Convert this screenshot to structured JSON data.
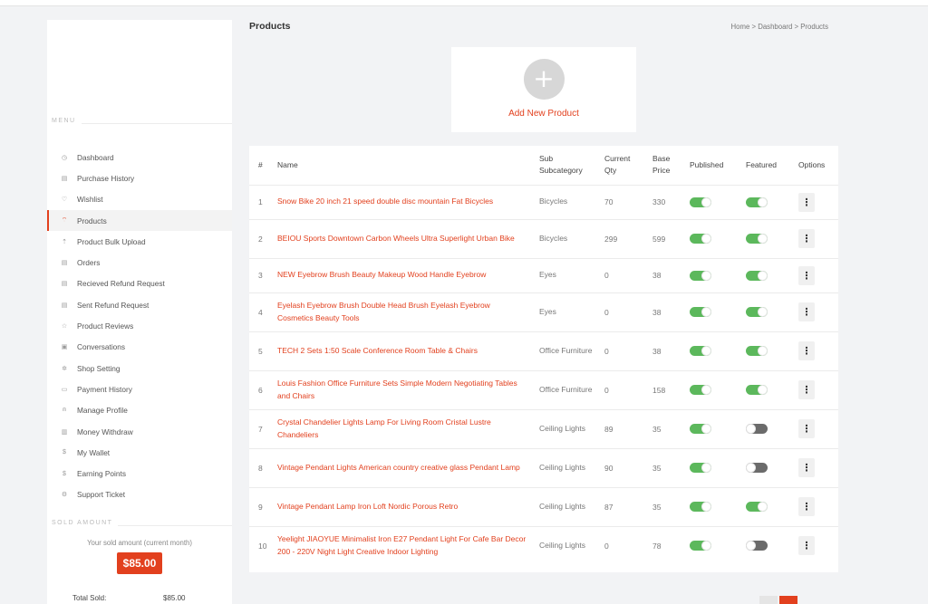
{
  "sidebar": {
    "menu_heading": "MENU",
    "items": [
      {
        "label": "Dashboard",
        "icon": "◷"
      },
      {
        "label": "Purchase History",
        "icon": "▤"
      },
      {
        "label": "Wishlist",
        "icon": "♡"
      },
      {
        "label": "Products",
        "icon": "⌔"
      },
      {
        "label": "Product Bulk Upload",
        "icon": "⇡"
      },
      {
        "label": "Orders",
        "icon": "▤"
      },
      {
        "label": "Recieved Refund Request",
        "icon": "▤"
      },
      {
        "label": "Sent Refund Request",
        "icon": "▤"
      },
      {
        "label": "Product Reviews",
        "icon": "☆"
      },
      {
        "label": "Conversations",
        "icon": "▣"
      },
      {
        "label": "Shop Setting",
        "icon": "✲"
      },
      {
        "label": "Payment History",
        "icon": "▭"
      },
      {
        "label": "Manage Profile",
        "icon": "⍝"
      },
      {
        "label": "Money Withdraw",
        "icon": "▥"
      },
      {
        "label": "My Wallet",
        "icon": "$"
      },
      {
        "label": "Earning Points",
        "icon": "$"
      },
      {
        "label": "Support Ticket",
        "icon": "⚙"
      }
    ],
    "sold_heading": "SOLD AMOUNT",
    "sold_label": "Your sold amount (current month)",
    "sold_value": "$85.00",
    "total_label": "Total Sold:",
    "total_value": "$85.00"
  },
  "header": {
    "title": "Products",
    "breadcrumb": "Home > Dashboard > Products"
  },
  "add_product": {
    "icon": "+",
    "label": "Add New Product"
  },
  "table": {
    "col_num": "#",
    "col_name": "Name",
    "col_sub_1": "Sub",
    "col_sub_2": "Subcategory",
    "col_qty_1": "Current",
    "col_qty_2": "Qty",
    "col_price_1": "Base",
    "col_price_2": "Price",
    "col_published": "Published",
    "col_featured": "Featured",
    "col_options": "Options",
    "option_icon": "⋮",
    "rows": [
      {
        "num": "1",
        "name": "Snow Bike 20 inch 21 speed double disc mountain Fat Bicycles",
        "sub": "Bicycles",
        "qty": "70",
        "price": "330",
        "published": true,
        "featured": true
      },
      {
        "num": "2",
        "name": "BEIOU Sports Downtown Carbon Wheels Ultra Superlight Urban Bike",
        "sub": "Bicycles",
        "qty": "299",
        "price": "599",
        "published": true,
        "featured": true
      },
      {
        "num": "3",
        "name": "NEW Eyebrow Brush Beauty Makeup Wood Handle Eyebrow",
        "sub": "Eyes",
        "qty": "0",
        "price": "38",
        "published": true,
        "featured": true
      },
      {
        "num": "4",
        "name": "Eyelash Eyebrow Brush Double Head Brush Eyelash Eyebrow Cosmetics Beauty Tools",
        "sub": "Eyes",
        "qty": "0",
        "price": "38",
        "published": true,
        "featured": true
      },
      {
        "num": "5",
        "name": "TECH 2 Sets 1:50 Scale Conference Room Table & Chairs",
        "sub": "Office Furniture",
        "qty": "0",
        "price": "38",
        "published": true,
        "featured": true
      },
      {
        "num": "6",
        "name": "Louis Fashion Office Furniture Sets Simple Modern Negotiating Tables and Chairs",
        "sub": "Office Furniture",
        "qty": "0",
        "price": "158",
        "published": true,
        "featured": true
      },
      {
        "num": "7",
        "name": "Crystal Chandelier Lights Lamp For Living Room Cristal Lustre Chandeliers",
        "sub": "Ceiling Lights",
        "qty": "89",
        "price": "35",
        "published": true,
        "featured": false
      },
      {
        "num": "8",
        "name": "Vintage Pendant Lights American country creative glass Pendant Lamp",
        "sub": "Ceiling Lights",
        "qty": "90",
        "price": "35",
        "published": true,
        "featured": false
      },
      {
        "num": "9",
        "name": "Vintage Pendant Lamp Iron Loft Nordic Porous Retro",
        "sub": "Ceiling Lights",
        "qty": "87",
        "price": "35",
        "published": true,
        "featured": true
      },
      {
        "num": "10",
        "name": "Yeelight JIAOYUE Minimalist Iron E27 Pendant Light For Cafe Bar Decor 200 - 220V Night Light Creative Indoor Lighting",
        "sub": "Ceiling Lights",
        "qty": "0",
        "price": "78",
        "published": true,
        "featured": false
      }
    ]
  },
  "colors": {
    "accent": "#e2401e",
    "toggle_on": "#5cb85c",
    "toggle_off": "#6b6b6b"
  }
}
